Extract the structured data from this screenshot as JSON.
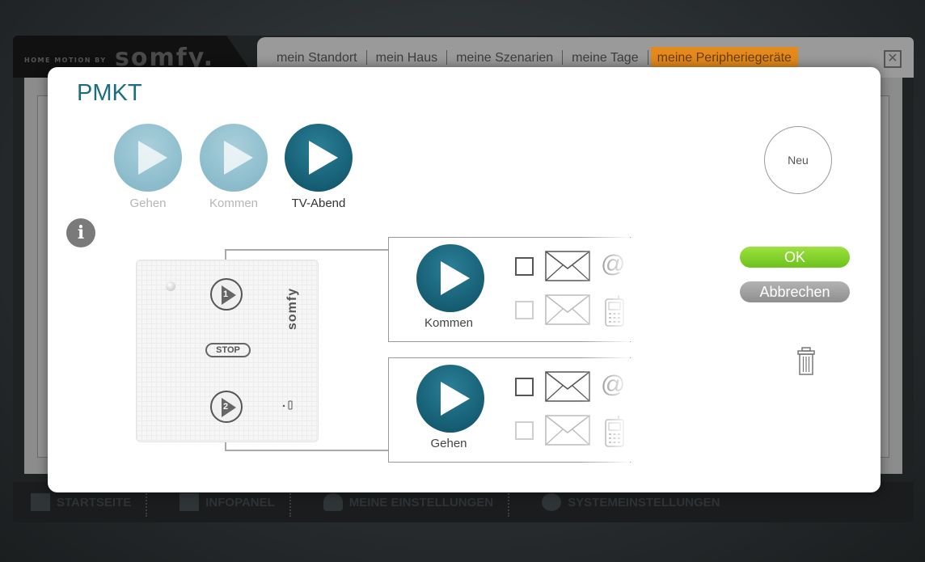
{
  "brand": {
    "sub": "HOME MOTION BY",
    "logo": "somfy."
  },
  "tabs": [
    {
      "label": "mein Standort",
      "active": false
    },
    {
      "label": "mein Haus",
      "active": false
    },
    {
      "label": "meine Szenarien",
      "active": false
    },
    {
      "label": "meine Tage",
      "active": false
    },
    {
      "label": "meine Peripheriegeräte",
      "active": true
    }
  ],
  "close_label": "✕",
  "bottom_nav": [
    {
      "label": "STARTSEITE"
    },
    {
      "label": "INFOPANEL"
    },
    {
      "label": "MEINE EINSTELLUNGEN"
    },
    {
      "label": "SYSTEMEINSTELLUNGEN"
    }
  ],
  "modal": {
    "title": "PMKT",
    "scenarios": [
      {
        "label": "Gehen",
        "selected": false
      },
      {
        "label": "Kommen",
        "selected": false
      },
      {
        "label": "TV-Abend",
        "selected": true
      }
    ],
    "new_label": "Neu",
    "info_label": "i",
    "ok_label": "OK",
    "cancel_label": "Abbrechen",
    "remote": {
      "logo": "somfy",
      "stop_label": "STOP",
      "button_1": "1",
      "button_2": "2"
    },
    "actions": [
      {
        "label": "Kommen",
        "email_checked": false,
        "sms_checked": false
      },
      {
        "label": "Gehen",
        "email_checked": false,
        "sms_checked": false
      }
    ],
    "at_symbol": "@"
  },
  "colors": {
    "accent_teal": "#1e6e82",
    "tab_active": "#e48a1c",
    "ok_green": "#7ed321",
    "cancel_gray": "#9b9b9b",
    "play_dark": "#0d4f63",
    "play_light": "#7fb4c5"
  }
}
